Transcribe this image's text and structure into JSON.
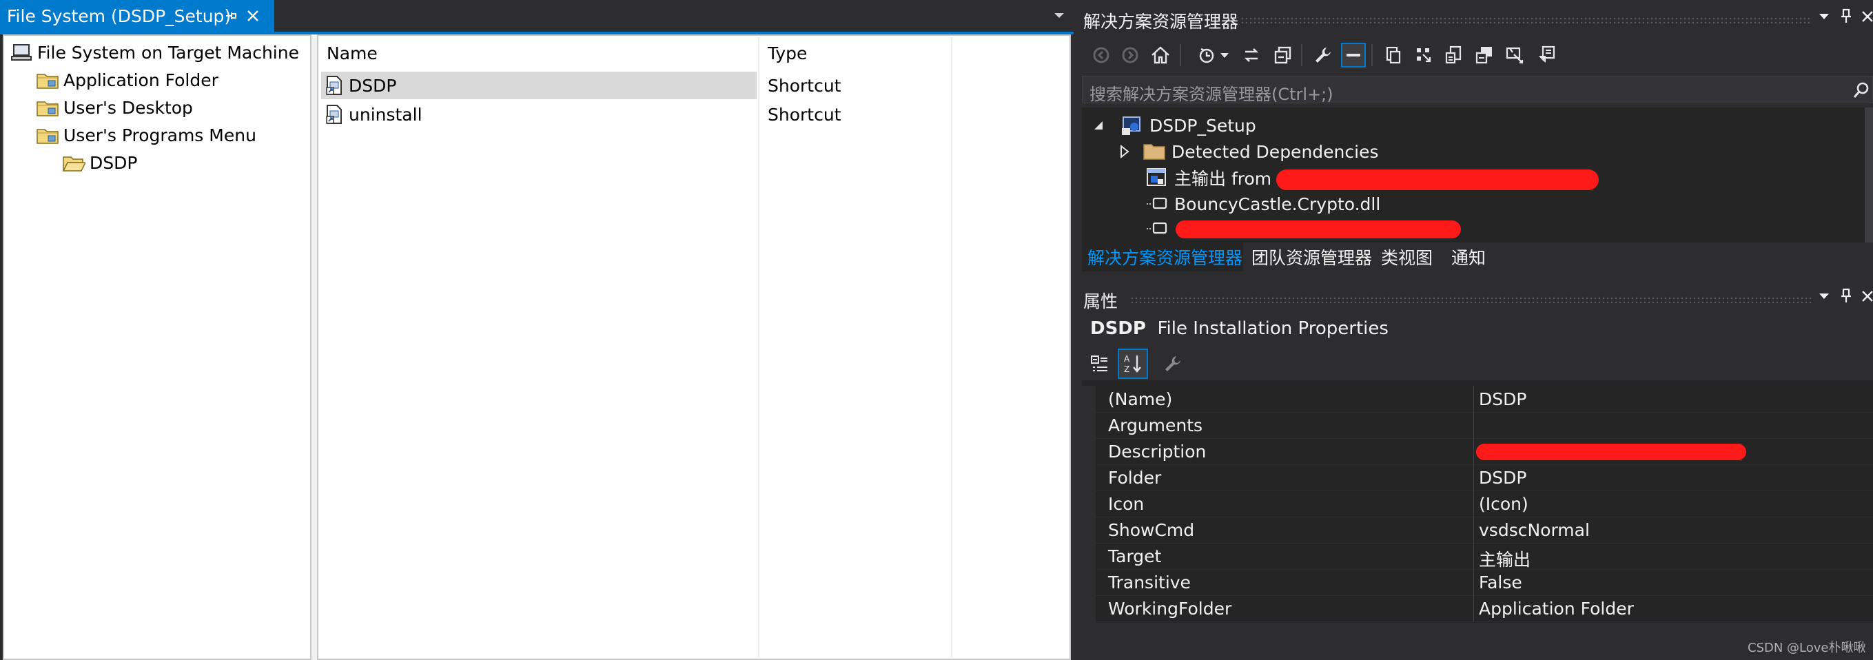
{
  "document_tab": {
    "title": "File System (DSDP_Setup)",
    "accent_color": "#007acc"
  },
  "file_system_tree": {
    "root": "File System on Target Machine",
    "items": [
      {
        "label": "Application Folder",
        "icon": "folder-icon"
      },
      {
        "label": "User's Desktop",
        "icon": "folder-icon"
      },
      {
        "label": "User's Programs Menu",
        "icon": "folder-icon"
      },
      {
        "label": "DSDP",
        "icon": "folder-open-icon"
      }
    ]
  },
  "file_list": {
    "columns": [
      "Name",
      "Type"
    ],
    "rows": [
      {
        "name": "DSDP",
        "type": "Shortcut",
        "selected": true
      },
      {
        "name": "uninstall",
        "type": "Shortcut",
        "selected": false
      }
    ]
  },
  "solution_explorer": {
    "title": "解决方案资源管理器",
    "search_placeholder": "搜索解决方案资源管理器(Ctrl+;)",
    "nodes": [
      {
        "label": "DSDP_Setup",
        "expanded": true
      },
      {
        "label": "Detected Dependencies",
        "expanded": false
      },
      {
        "label": "主输出 from"
      },
      {
        "label": "BouncyCastle.Crypto.dll"
      }
    ],
    "redaction_color": "#ff1a1a"
  },
  "bottom_tabs": {
    "items": [
      "解决方案资源管理器",
      "团队资源管理器",
      "类视图",
      "通知"
    ],
    "active_index": 0
  },
  "properties": {
    "title": "属性",
    "object_name": "DSDP",
    "object_type": "File Installation Properties",
    "rows": [
      {
        "name": "(Name)",
        "value": "DSDP"
      },
      {
        "name": "Arguments",
        "value": ""
      },
      {
        "name": "Description",
        "value": ""
      },
      {
        "name": "Folder",
        "value": "DSDP"
      },
      {
        "name": "Icon",
        "value": "(Icon)"
      },
      {
        "name": "ShowCmd",
        "value": "vsdscNormal"
      },
      {
        "name": "Target",
        "value": "主输出"
      },
      {
        "name": "Transitive",
        "value": "False"
      },
      {
        "name": "WorkingFolder",
        "value": "Application Folder"
      }
    ]
  },
  "watermark": "CSDN @Love朴啾啾"
}
